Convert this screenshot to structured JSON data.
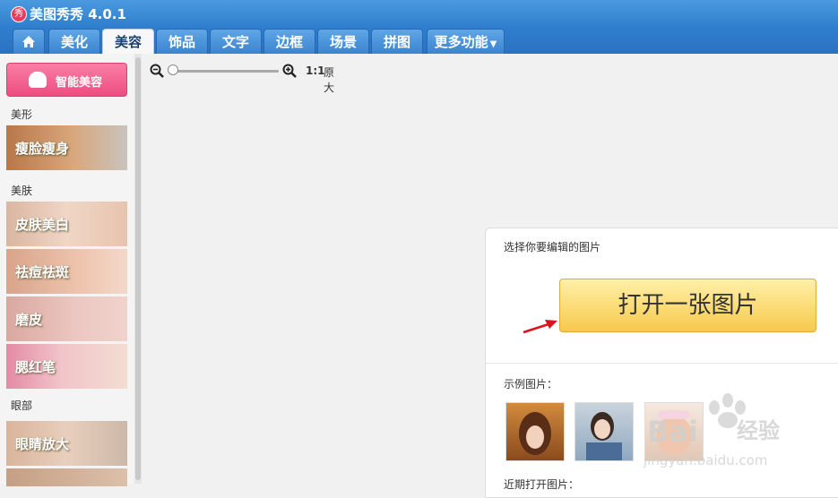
{
  "app": {
    "title": "美图秀秀 4.0.1",
    "logo_text": "秀"
  },
  "tabs": [
    {
      "label": "美化"
    },
    {
      "label": "美容"
    },
    {
      "label": "饰品"
    },
    {
      "label": "文字"
    },
    {
      "label": "边框"
    },
    {
      "label": "场景"
    },
    {
      "label": "拼图"
    },
    {
      "label": "更多功能"
    }
  ],
  "active_tab": "美容",
  "sidebar": {
    "smart_button": "智能美容",
    "sections": [
      {
        "label": "美形",
        "items": [
          "瘦脸瘦身"
        ]
      },
      {
        "label": "美肤",
        "items": [
          "皮肤美白",
          "祛痘祛斑",
          "磨皮",
          "腮红笔"
        ]
      },
      {
        "label": "眼部",
        "items": [
          "眼睛放大"
        ]
      }
    ]
  },
  "zoom": {
    "ratio": "1:1",
    "label": "原大",
    "level": 0
  },
  "panel": {
    "choose_text": "选择你要编辑的图片",
    "open_button": "打开一张图片",
    "examples_label": "示例图片：",
    "recent_label": "近期打开图片："
  },
  "watermark": {
    "brand": "Bai",
    "brand_cn": "经验",
    "url": "jingyan.baidu.com"
  },
  "colors": {
    "accent": "#2f7fce",
    "pink": "#ec4d80",
    "open_button": "#f7c94c",
    "arrow": "#d9141b"
  }
}
